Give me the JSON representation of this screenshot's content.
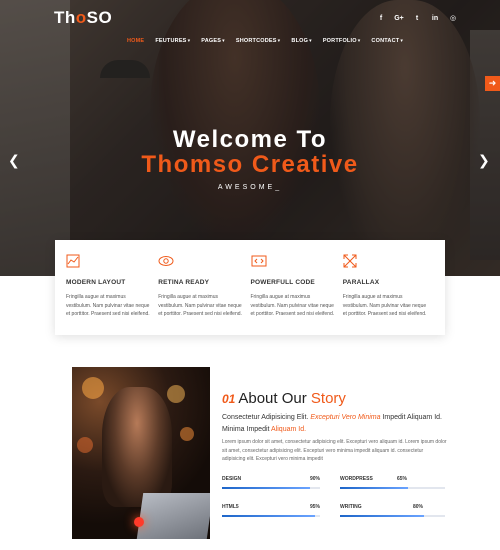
{
  "brand": {
    "logo_pre": "Th",
    "logo_accent": "o",
    "logo_post": "SO",
    "accent_color": "#f05a1a"
  },
  "social": [
    {
      "icon": "facebook-icon",
      "glyph": "f"
    },
    {
      "icon": "google-plus-icon",
      "glyph": "G+"
    },
    {
      "icon": "twitter-icon",
      "glyph": "t"
    },
    {
      "icon": "linkedin-icon",
      "glyph": "in"
    },
    {
      "icon": "instagram-icon",
      "glyph": "◎"
    }
  ],
  "nav": [
    {
      "label": "HOME",
      "active": true
    },
    {
      "label": "FEUTURES",
      "active": false
    },
    {
      "label": "PAGES",
      "active": false
    },
    {
      "label": "SHORTCODES",
      "active": false
    },
    {
      "label": "BLOG",
      "active": false
    },
    {
      "label": "PORTFOLIO",
      "active": false
    },
    {
      "label": "CONTACT",
      "active": false
    }
  ],
  "hero": {
    "title_line1": "Welcome To",
    "title_line2": "Thomso Creative",
    "subtitle": "AWESOME_"
  },
  "features": [
    {
      "icon": "chart-icon",
      "title": "MODERN LAYOUT",
      "desc": "Fringilla augue at maximus vestibulum. Nam pulvinar vitae neque et porttitor. Praesent sed nisi eleifend."
    },
    {
      "icon": "eye-icon",
      "title": "RETINA READY",
      "desc": "Fringilla augue at maximus vestibulum. Nam pulvinar vitae neque et porttitor. Praesent sed nisi eleifend."
    },
    {
      "icon": "code-icon",
      "title": "POWERFULL CODE",
      "desc": "Fringilla augue at maximus vestibulum. Nam pulvinar vitae neque et porttitor. Praesent sed nisi eleifend."
    },
    {
      "icon": "expand-icon",
      "title": "PARALLAX",
      "desc": "Fringilla augue at maximus vestibulum. Nam pulvinar vitae neque et porttitor. Praesent sed nisi eleifend."
    }
  ],
  "about": {
    "number": "01",
    "title_plain": "About Our",
    "title_accent": "Story",
    "lead_part1": "Consectetur Adipisicing Elit.",
    "lead_italic": "Excepturi Vero Minima",
    "lead_part2": "Impedit Aliquam Id. Minima Impedit",
    "lead_accent": "Aliquam Id.",
    "body": "Lorem ipsum dolor sit amet, consectetur adipisicing elit. Excepturi vero aliquam id. Lorem ipsum dolor sit amet, consectetur adipisicing elit. Excepturi vero minima impedit aliquam id. consectetur adipisicing elit. Excepturi vero minima impedit"
  },
  "skills": [
    {
      "label": "DESIGN",
      "value": "90%",
      "level": 90
    },
    {
      "label": "WORDPRESS",
      "value": "65%",
      "level": 65
    },
    {
      "label": "HTML5",
      "value": "95%",
      "level": 95
    },
    {
      "label": "WRITING",
      "value": "80%",
      "level": 80
    }
  ]
}
